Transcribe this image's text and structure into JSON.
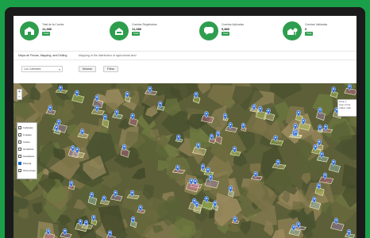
{
  "kpis": [
    {
      "label": "Total de la Cuenta",
      "value": "11,380",
      "badge": "Total",
      "icon": "farm-icon"
    },
    {
      "label": "Cuentas Registradas",
      "value": "11,380",
      "badge": "Total",
      "icon": "house-icon"
    },
    {
      "label": "Cuentas Aplicadas",
      "value": "9,880",
      "badge": "Total",
      "icon": "chat-icon"
    },
    {
      "label": "Cuentas Validadas",
      "value": "0",
      "badge": "Total",
      "icon": "house-tree-icon"
    }
  ],
  "tabs": [
    {
      "label": "Mapa de Fincas, Mapping, and Drilling",
      "active": true
    },
    {
      "label": "Mapping of the distribution of agricultural land",
      "active": false
    }
  ],
  "controls": {
    "select_value": "Los Cafetales",
    "btn_primary": "Mostrar",
    "btn_secondary": "Filtrar"
  },
  "zoom": {
    "plus": "+",
    "minus": "−"
  },
  "legend": {
    "items": [
      {
        "label": "Cafetales",
        "checked": false
      },
      {
        "label": "Frutales",
        "checked": false
      },
      {
        "label": "Cacao",
        "checked": false
      },
      {
        "label": "Hortalizas",
        "checked": false
      },
      {
        "label": "Ganaderia",
        "checked": false
      },
      {
        "label": "Parcela",
        "checked": true
      },
      {
        "label": "Otras Areas",
        "checked": false
      }
    ]
  },
  "tooltip": {
    "line1": "Finca: 1",
    "line2": "Área: 3.0 ha",
    "line3": "Cultivo: Café"
  },
  "colors": {
    "brand": "#2e9e4e",
    "background": "#1aa049",
    "marker": "#2f6fe0"
  }
}
